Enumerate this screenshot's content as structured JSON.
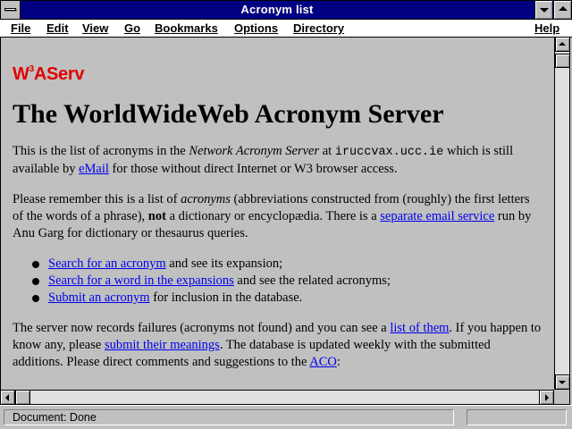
{
  "window": {
    "title": "Acronym list"
  },
  "menubar": {
    "file": "File",
    "edit": "Edit",
    "view": "View",
    "go": "Go",
    "bookmarks": "Bookmarks",
    "options": "Options",
    "directory": "Directory",
    "help": "Help"
  },
  "page": {
    "logo_pre": "W",
    "logo_sup": "3",
    "logo_post": "AServ",
    "heading": "The WorldWideWeb Acronym Server",
    "p1": {
      "t1": "This is the list of acronyms in the ",
      "em": "Network Acronym Server",
      "t2": " at ",
      "host": "iruccvax.ucc.ie",
      "t3": " which is still available by ",
      "link": "eMail",
      "t4": " for those without direct Internet or W3 browser access."
    },
    "p2": {
      "t1": "Please remember this is a list of ",
      "em": "acronyms",
      "t2": " (abbreviations constructed from (roughly) the first letters of the words of a phrase), ",
      "strong": "not",
      "t3": " a dictionary or encyclopædia. There is a ",
      "link": "separate email service",
      "t4": " run by Anu Garg for dictionary or thesaurus queries."
    },
    "bullets": [
      {
        "link": "Search for an acronym",
        "text": " and see its expansion;"
      },
      {
        "link": "Search for a word in the expansions",
        "text": " and see the related acronyms;"
      },
      {
        "link": "Submit an acronym",
        "text": " for inclusion in the database."
      }
    ],
    "p3": {
      "t1": "The server now records failures (acronyms not found) and you can see a ",
      "link1": "list of them",
      "t2": ". If you happen to know any, please ",
      "link2": "submit their meanings",
      "t3": ". The database is updated weekly with the submitted additions. Please direct comments and suggestions to the ",
      "link3": "ACO",
      "t4": ":"
    }
  },
  "status": {
    "text": "Document: Done"
  },
  "colors": {
    "titlebar": "#000080",
    "link": "#0000ee",
    "logo": "#e00000",
    "background": "#c0c0c0"
  }
}
